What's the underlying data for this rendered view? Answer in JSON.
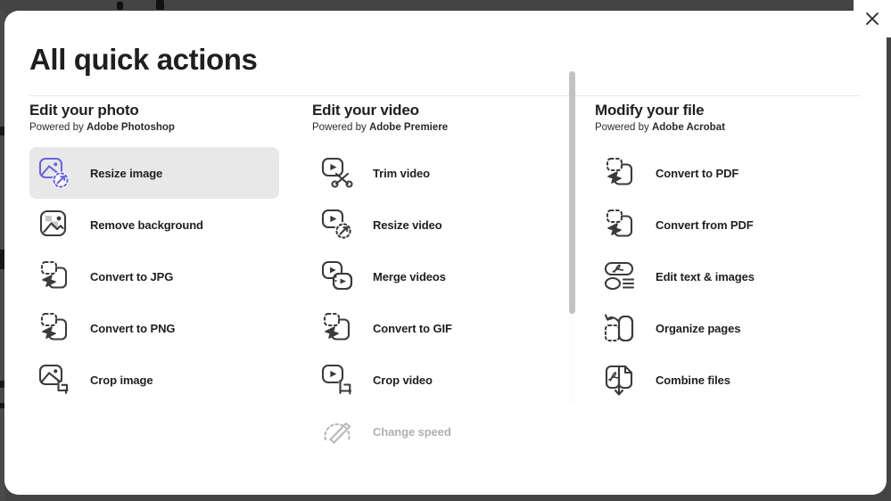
{
  "window": {
    "background_color": "#444444",
    "modal_background": "#ffffff"
  },
  "close_button": {
    "name": "close",
    "icon": "close-icon",
    "label": "×"
  },
  "modal": {
    "title": "All quick actions",
    "accent_color": "#6a64e8",
    "highlight_color": "#e8e8e8",
    "disabled_color": "#b0b0b0"
  },
  "columns": [
    {
      "title": "Edit your photo",
      "powered_prefix": "Powered by ",
      "powered_brand": "Adobe Photoshop",
      "items": [
        {
          "label": "Resize image",
          "icon": "image-resize-icon",
          "state": "active",
          "icon_color": "#6a64e8"
        },
        {
          "label": "Remove background",
          "icon": "image-remove-bg-icon",
          "state": "default",
          "icon_color": "#3b3b3b"
        },
        {
          "label": "Convert to JPG",
          "icon": "convert-format-icon",
          "state": "default",
          "icon_color": "#3b3b3b"
        },
        {
          "label": "Convert to PNG",
          "icon": "convert-format-icon",
          "state": "default",
          "icon_color": "#3b3b3b"
        },
        {
          "label": "Crop image",
          "icon": "image-crop-icon",
          "state": "default",
          "icon_color": "#3b3b3b"
        }
      ]
    },
    {
      "title": "Edit your video",
      "powered_prefix": "Powered by ",
      "powered_brand": "Adobe Premiere",
      "items": [
        {
          "label": "Trim video",
          "icon": "video-trim-icon",
          "state": "default",
          "icon_color": "#3b3b3b"
        },
        {
          "label": "Resize video",
          "icon": "video-resize-icon",
          "state": "default",
          "icon_color": "#3b3b3b"
        },
        {
          "label": "Merge videos",
          "icon": "video-merge-icon",
          "state": "default",
          "icon_color": "#3b3b3b"
        },
        {
          "label": "Convert to GIF",
          "icon": "convert-format-icon",
          "state": "default",
          "icon_color": "#3b3b3b"
        },
        {
          "label": "Crop video",
          "icon": "video-crop-icon",
          "state": "default",
          "icon_color": "#3b3b3b"
        },
        {
          "label": "Change speed",
          "icon": "speedometer-icon",
          "state": "disabled",
          "icon_color": "#b8b8b8"
        }
      ]
    },
    {
      "title": "Modify your file",
      "powered_prefix": "Powered by ",
      "powered_brand": "Adobe Acrobat",
      "items": [
        {
          "label": "Convert to PDF",
          "icon": "convert-format-icon",
          "state": "default",
          "icon_color": "#3b3b3b"
        },
        {
          "label": "Convert from PDF",
          "icon": "convert-format-icon",
          "state": "default",
          "icon_color": "#3b3b3b"
        },
        {
          "label": "Edit text & images",
          "icon": "pdf-edit-icon",
          "state": "default",
          "icon_color": "#3b3b3b"
        },
        {
          "label": "Organize pages",
          "icon": "organize-pages-icon",
          "state": "default",
          "icon_color": "#3b3b3b"
        },
        {
          "label": "Combine files",
          "icon": "combine-files-icon",
          "state": "default",
          "icon_color": "#3b3b3b"
        }
      ]
    }
  ],
  "scrollbar": {
    "name": "video-column-scrollbar",
    "orientation": "vertical"
  }
}
